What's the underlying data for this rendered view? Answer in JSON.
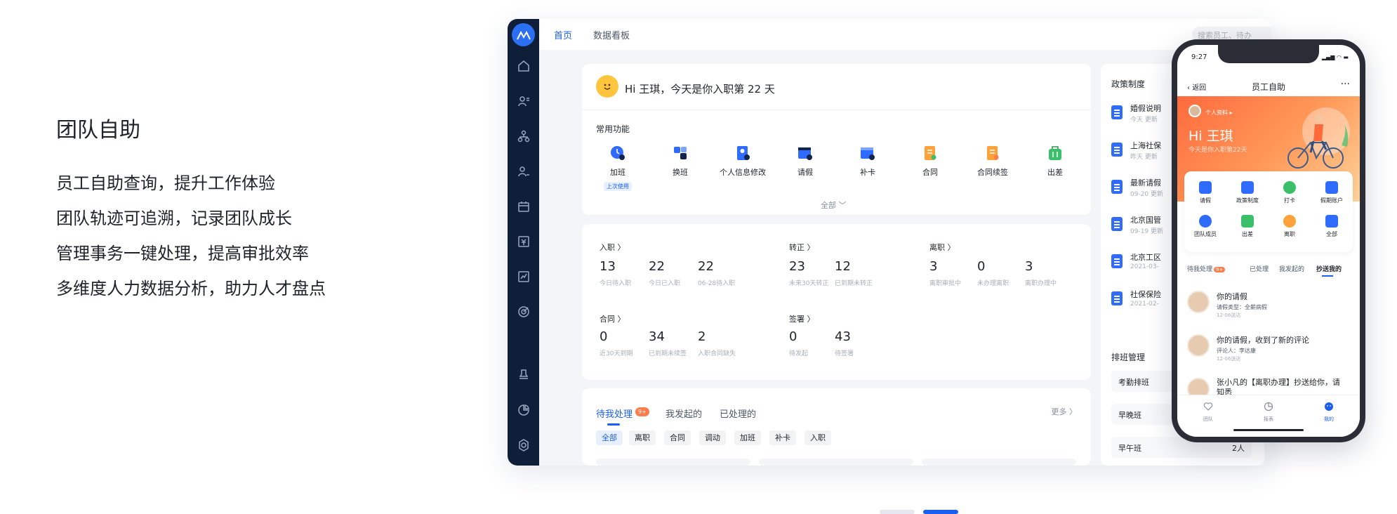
{
  "intro": {
    "heading": "团队自助",
    "lines": [
      "员工自助查询，提升工作体验",
      "团队轨迹可追溯，记录团队成长",
      "管理事务一键处理，提高审批效率",
      "多维度人力数据分析，助力人才盘点"
    ]
  },
  "desktop": {
    "tabs": [
      "首页",
      "数据看板"
    ],
    "search_placeholder": "搜索员工、待办",
    "greeting": "Hi 王琪，今天是你入职第 22 天",
    "common_title": "常用功能",
    "functions": [
      {
        "label": "加班",
        "icon": "overtime-clock-icon",
        "color": "#2f6bff",
        "tag": "上次使用"
      },
      {
        "label": "换班",
        "icon": "swap-shift-icon",
        "color": "#2f6bff"
      },
      {
        "label": "个人信息修改",
        "icon": "profile-edit-icon",
        "color": "#2f6bff"
      },
      {
        "label": "请假",
        "icon": "leave-calendar-icon",
        "color": "#2f6bff"
      },
      {
        "label": "补卡",
        "icon": "card-calendar-icon",
        "color": "#2f6bff"
      },
      {
        "label": "合同",
        "icon": "contract-icon",
        "color": "#ffa23a"
      },
      {
        "label": "合同续签",
        "icon": "contract-renew-icon",
        "color": "#ffa23a"
      },
      {
        "label": "出差",
        "icon": "suitcase-icon",
        "color": "#3bbf6a"
      }
    ],
    "all_label": "全部",
    "stats": {
      "onboard": {
        "title": "入职",
        "items": [
          {
            "v": "13",
            "l": "今日待入职"
          },
          {
            "v": "22",
            "l": "今日已入职"
          },
          {
            "v": "22",
            "l": "06-28待入职"
          }
        ]
      },
      "regular": {
        "title": "转正",
        "items": [
          {
            "v": "23",
            "l": "未来30天转正"
          },
          {
            "v": "12",
            "l": "已到期未转正"
          }
        ]
      },
      "leave": {
        "title": "离职",
        "items": [
          {
            "v": "3",
            "l": "离职审批中"
          },
          {
            "v": "0",
            "l": "未办理离职"
          },
          {
            "v": "3",
            "l": "离职办理中"
          }
        ]
      },
      "contract": {
        "title": "合同",
        "items": [
          {
            "v": "0",
            "l": "近30天到期"
          },
          {
            "v": "34",
            "l": "已到期未续签"
          },
          {
            "v": "2",
            "l": "入职合同缺失"
          }
        ]
      },
      "sign": {
        "title": "签署",
        "items": [
          {
            "v": "0",
            "l": "待发起"
          },
          {
            "v": "43",
            "l": "待签署"
          }
        ]
      }
    },
    "pending": {
      "tabs": [
        "待我处理",
        "我发起的",
        "已处理的"
      ],
      "badge": "9+",
      "more": "更多",
      "chips": [
        "全部",
        "离职",
        "合同",
        "调动",
        "加班",
        "补卡",
        "入职"
      ]
    },
    "policy": {
      "title": "政策制度",
      "docs": [
        {
          "name": "婚假说明",
          "date": "今天 更新"
        },
        {
          "name": "上海社保",
          "date": "昨天 更新"
        },
        {
          "name": "最新请假",
          "date": "09-20 更新"
        },
        {
          "name": "北京国管",
          "date": "09-19 更新"
        },
        {
          "name": "北京工区",
          "date": "2021-03-"
        },
        {
          "name": "社保保险",
          "date": "2021-02-"
        }
      ]
    },
    "shift": {
      "title": "排班管理",
      "rows": [
        {
          "name": "考勤排班",
          "count": ""
        },
        {
          "name": "早晚班",
          "count": ""
        },
        {
          "name": "早午班",
          "count": "2人"
        }
      ]
    }
  },
  "phone": {
    "time": "9:27",
    "back": "返回",
    "title": "员工自助",
    "more": "···",
    "profile_label": "个人资料 ▸",
    "hi": "Hi 王琪",
    "sub": "今天是你入职第22天",
    "grid": [
      {
        "label": "请假",
        "color": "#2f6bff"
      },
      {
        "label": "政策制度",
        "color": "#2f6bff"
      },
      {
        "label": "打卡",
        "color": "#3bbf6a"
      },
      {
        "label": "假期账户",
        "color": "#2f6bff"
      },
      {
        "label": "团队成员",
        "color": "#2f6bff"
      },
      {
        "label": "出差",
        "color": "#3bbf6a"
      },
      {
        "label": "离职",
        "color": "#ffa23a"
      },
      {
        "label": "全部",
        "color": "#2f6bff"
      }
    ],
    "tabs": [
      "待我处理",
      "已处理",
      "我发起的",
      "抄送我的"
    ],
    "badge": "9+",
    "messages": [
      {
        "title": "你的请假",
        "line": "请假类型：全薪病假",
        "date": "12-06送达"
      },
      {
        "title": "你的请假，收到了新的评论",
        "line": "评论人：李达康",
        "date": "12-06送达"
      },
      {
        "title": "张小凡的【离职办理】抄送给你，请知悉",
        "line": "",
        "date": ""
      }
    ],
    "tabbar": [
      "团队",
      "报表",
      "我的"
    ]
  }
}
